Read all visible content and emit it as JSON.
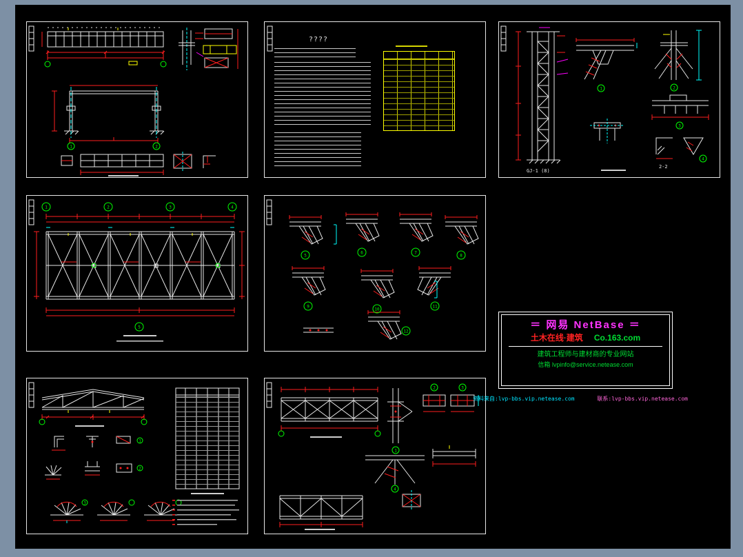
{
  "colors": {
    "workspace_bg": "#7d90a5",
    "canvas_bg": "#000000",
    "drawing_line": "#e8e8e8",
    "dimension_line": "#ff1e1e",
    "auxiliary_line": "#00ffff",
    "node_bubble": "#00ff00",
    "table_grid": "#ffff00",
    "highlight": "#ff00ff"
  },
  "notes": {
    "title": "????"
  },
  "labels": {
    "gj": "GJ-1 (8)",
    "s22": "2-2"
  },
  "circles": {
    "p1": [
      "1",
      "2"
    ],
    "p3": [
      "1",
      "2",
      "3",
      "4"
    ],
    "p4": [
      "1",
      "2",
      "3",
      "4",
      "5"
    ],
    "p5": [
      "5",
      "6",
      "7",
      "8",
      "9",
      "10",
      "11",
      "12"
    ],
    "p6": [
      "1",
      "2",
      "3"
    ],
    "p7": [
      "1",
      "2",
      "3",
      "4"
    ]
  },
  "title_block": {
    "line1": "＝  网易 NetBase  ＝",
    "line2_left": "土木在线·建筑",
    "line2_right": "Co.163.com",
    "line3": "建筑工程师与建材商的专业网站",
    "line4": "信箱 lvpinfo@service.netease.com",
    "watermark_left": "资料来自:lvp-bbs.vip.netease.com",
    "watermark_right": "联系:lvp-bbs.vip.netease.com"
  }
}
